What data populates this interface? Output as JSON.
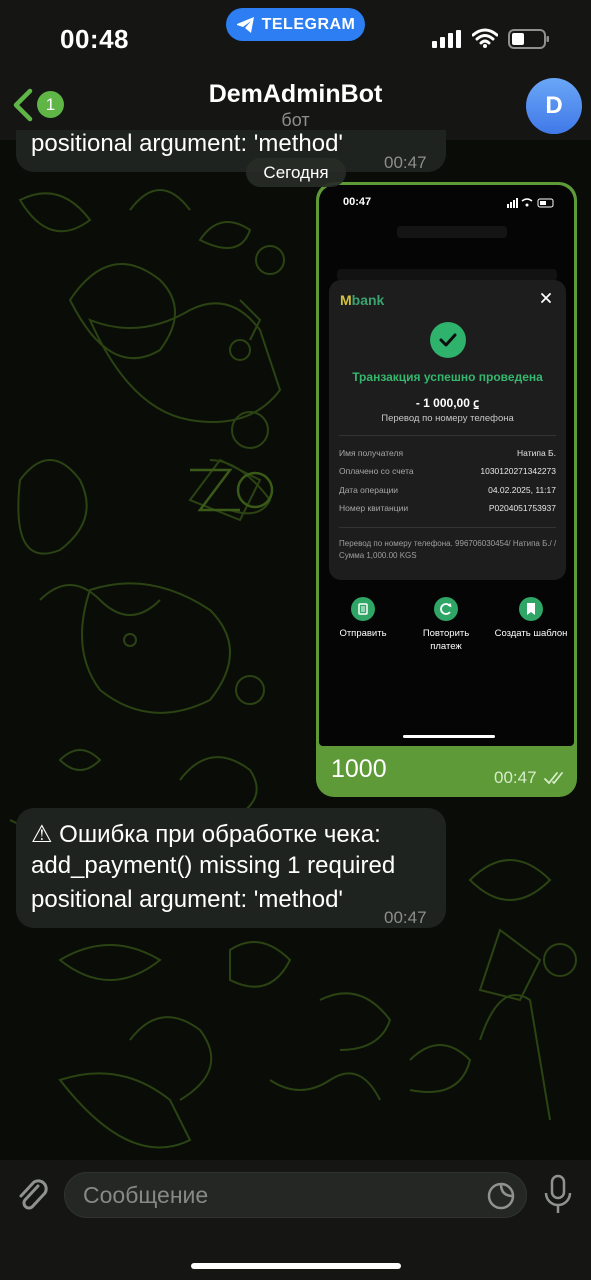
{
  "status_bar": {
    "time": "00:48",
    "app_pill": "TELEGRAM"
  },
  "header": {
    "back_badge": "1",
    "title": "DemAdminBot",
    "subtitle": "бот",
    "avatar_letter": "D"
  },
  "date_separator": "Сегодня",
  "messages": {
    "top": {
      "text": "positional argument: 'method'",
      "time": "00:47"
    },
    "outgoing": {
      "text": "1000",
      "time": "00:47",
      "photo": {
        "time": "00:47",
        "bank_logo_prefix": "M",
        "bank_logo": "bank",
        "status": "Транзакция успешно проведена",
        "amount": "- 1 000,00 ⃀",
        "transfer_type": "Перевод по номеру телефона",
        "rows": [
          {
            "label": "Имя получателя",
            "value": "Натипа Б."
          },
          {
            "label": "Оплачено со счета",
            "value": "1030120271342273"
          },
          {
            "label": "Дата операции",
            "value": "04.02.2025, 11:17"
          },
          {
            "label": "Номер квитанции",
            "value": "P0204051753937"
          }
        ],
        "description": "Перевод по номеру телефона. 996706030454/ Натипа Б./ / Сумма 1,000.00 KGS",
        "actions": [
          {
            "label": "Отправить"
          },
          {
            "label": "Повторить платеж"
          },
          {
            "label": "Создать шаблон"
          }
        ]
      }
    },
    "error": {
      "line1": "⚠ Ошибка при обработке чека:",
      "line2": "add_payment() missing 1 required",
      "line3": "positional argument: 'method'",
      "time": "00:47"
    }
  },
  "input": {
    "placeholder": "Сообщение"
  },
  "colors": {
    "accent_green": "#5e9a37",
    "telegram_blue": "#2c7ef2",
    "bank_green": "#2fb26b"
  },
  "icons": [
    "telegram-icon",
    "signal-icon",
    "wifi-icon",
    "battery-icon",
    "back-chevron-icon",
    "paperclip-icon",
    "sticker-icon",
    "microphone-icon",
    "checkmark-icon",
    "close-icon",
    "double-check-icon"
  ]
}
